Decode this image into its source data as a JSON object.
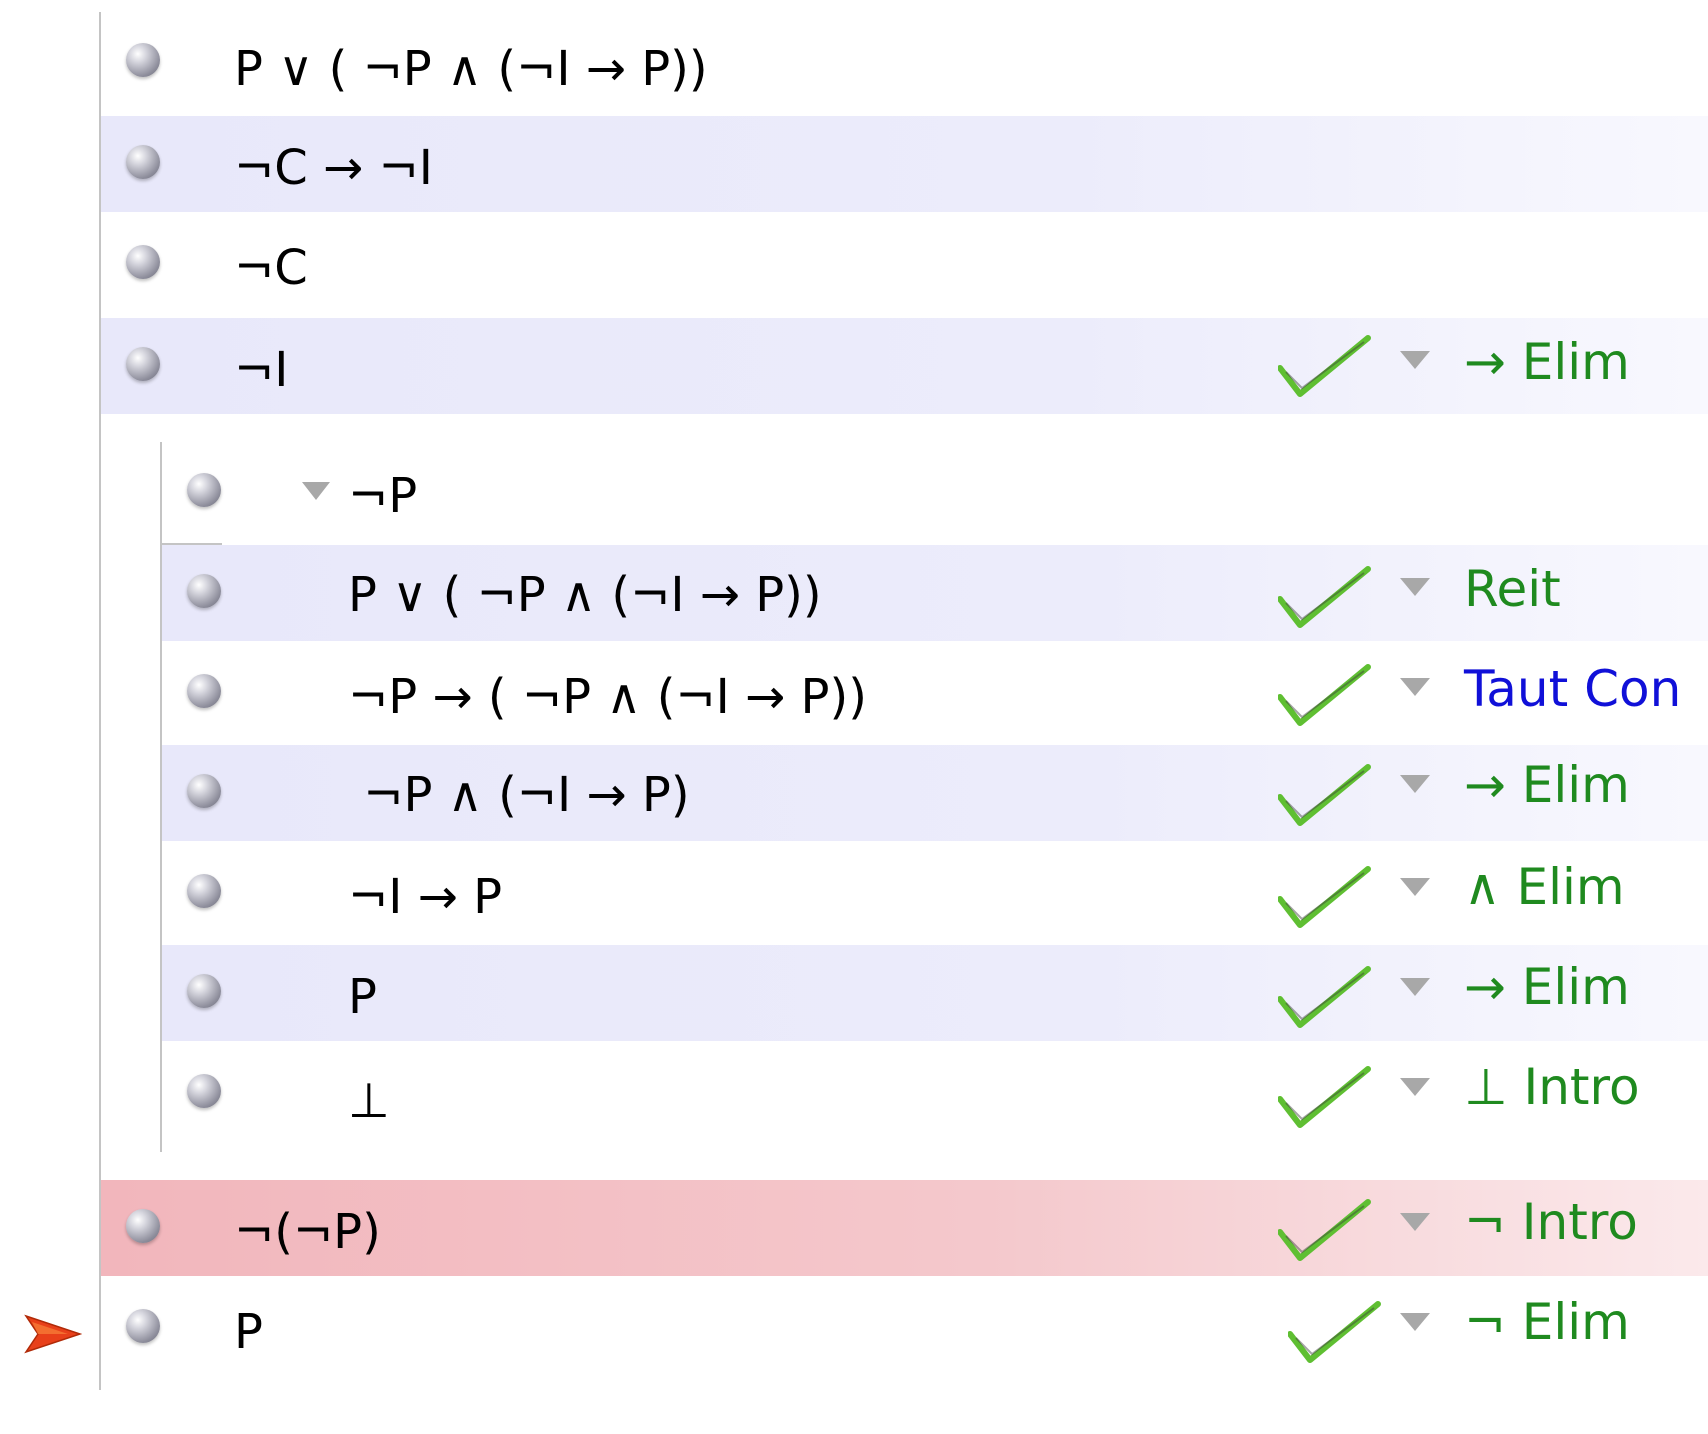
{
  "colors": {
    "rule_valid": "#1f8a1f",
    "rule_taut": "#1010d8",
    "row_shade": "#e8e8fa",
    "row_error": "#f2b6bc",
    "pointer": "#e8401a",
    "check": "#6cc23a"
  },
  "premises": [
    {
      "formula": "P ∨ ( ¬P ∧ (¬I → P))"
    },
    {
      "formula": "¬C → ¬I"
    },
    {
      "formula": "¬C"
    }
  ],
  "steps": [
    {
      "formula": "¬I",
      "rule": "→ Elim"
    },
    {
      "formula": "¬P",
      "rule": "",
      "subproof_assumption": true
    },
    {
      "formula": "P ∨ ( ¬P ∧ (¬I → P))",
      "rule": "Reit"
    },
    {
      "formula": "¬P → ( ¬P ∧ (¬I → P))",
      "rule": "Taut Con"
    },
    {
      "formula": " ¬P ∧ (¬I → P)",
      "rule": "→ Elim"
    },
    {
      "formula": "¬I → P",
      "rule": "∧ Elim"
    },
    {
      "formula": "P",
      "rule": "→ Elim"
    },
    {
      "formula": "⊥",
      "rule": "⊥ Intro"
    },
    {
      "formula": "¬(¬P)",
      "rule": "¬ Intro"
    },
    {
      "formula": "P",
      "rule": "¬ Elim"
    }
  ],
  "icons": {
    "bullet": "step-bullet-icon",
    "check": "checkmark-icon",
    "rule_menu": "dropdown-triangle-icon",
    "focus_pointer": "focus-arrow-icon"
  }
}
